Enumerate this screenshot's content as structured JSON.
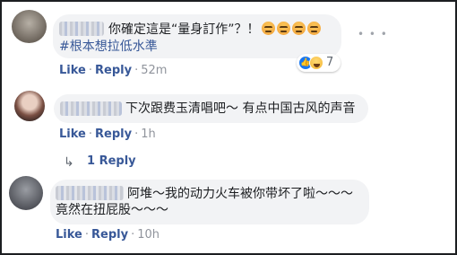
{
  "comments": [
    {
      "text": "你確定這是“量身訂作”？！",
      "hashtag": "#根本想拉低水準",
      "emoji_icons": [
        "angry-face-icon",
        "angry-face-icon",
        "angry-face-icon",
        "angry-face-icon"
      ],
      "like_label": "Like",
      "reply_label": "Reply",
      "time": "52m",
      "reaction_icons": [
        "like-icon",
        "haha-icon"
      ],
      "reaction_count": "7",
      "options_icon": "more-dots-icon"
    },
    {
      "text": "下次跟费玉清唱吧～ 有点中国古风的声音",
      "like_label": "Like",
      "reply_label": "Reply",
      "time": "1h",
      "replies_label": "1 Reply"
    },
    {
      "text_line1": "阿堆～我的动力火车被你带坏了啦～～～",
      "text_line2": "竟然在扭屁股～～～",
      "like_label": "Like",
      "reply_label": "Reply",
      "time": "10h"
    }
  ],
  "separator": "·",
  "colors": {
    "link": "#385898",
    "bubble": "#f2f3f5",
    "meta": "#90949c",
    "frame": "#1c1e21"
  }
}
